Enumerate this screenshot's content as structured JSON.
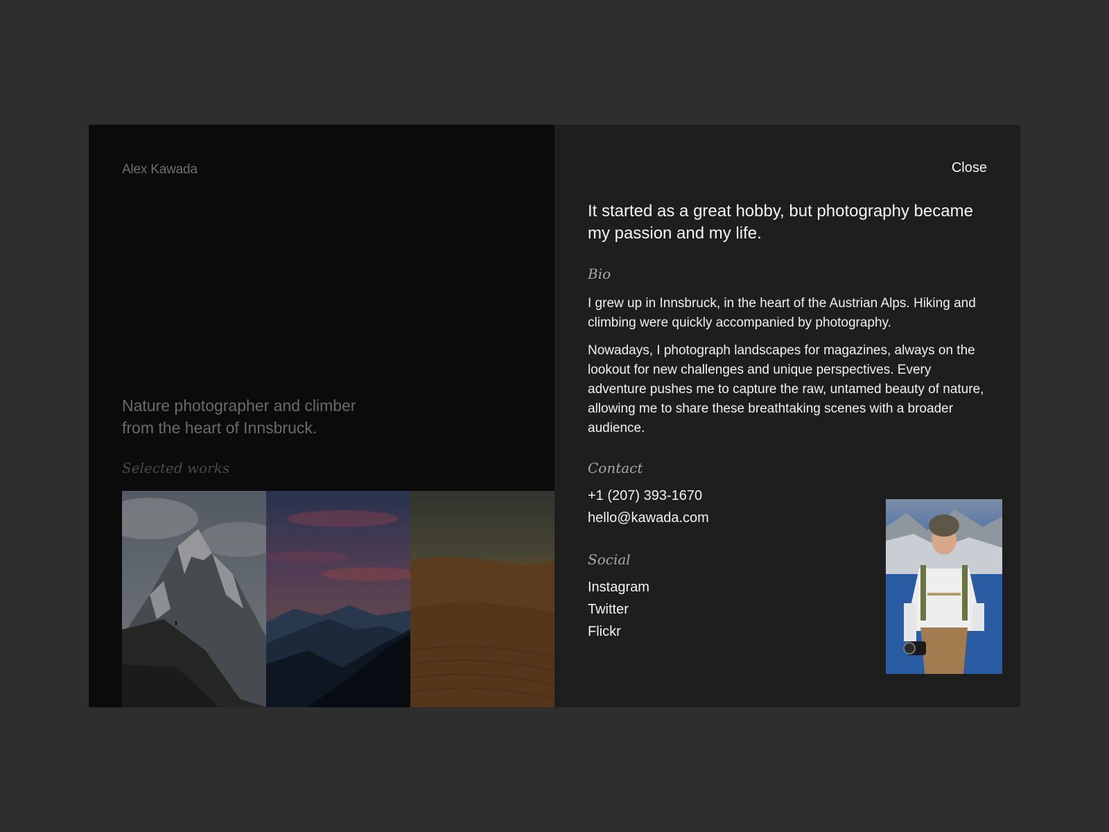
{
  "brand": "Alex Kawada",
  "tagline_line1": "Nature photographer and climber",
  "tagline_line2": "from the heart of Innsbruck.",
  "works_label": "Selected works",
  "works": [
    "mountain-peak-photo",
    "sunset-ridges-photo",
    "desert-dunes-photo"
  ],
  "close_label": "Close",
  "headline": "It started as a great hobby, but photography became my passion and my life.",
  "bio": {
    "label": "Bio",
    "p1": "I grew up in Innsbruck, in the heart of the Austrian Alps. Hiking and climbing were quickly accompanied by photography.",
    "p2": "Nowadays, I photograph landscapes for magazines, always on the lookout for new challenges and unique perspectives. Every adventure pushes me to capture the raw, untamed beauty of nature, allowing me to share these breathtaking scenes with a broader audience."
  },
  "contact": {
    "label": "Contact",
    "phone": "+1 (207) 393-1670",
    "email": "hello@kawada.com"
  },
  "social": {
    "label": "Social",
    "links": [
      "Instagram",
      "Twitter",
      "Flickr"
    ]
  },
  "colors": {
    "page_bg": "#2e2e2e",
    "left_panel": "#0b0b0b",
    "right_panel": "#1e1e1e",
    "text_primary": "#f2f2f2",
    "text_muted": "#6a6a6a"
  }
}
